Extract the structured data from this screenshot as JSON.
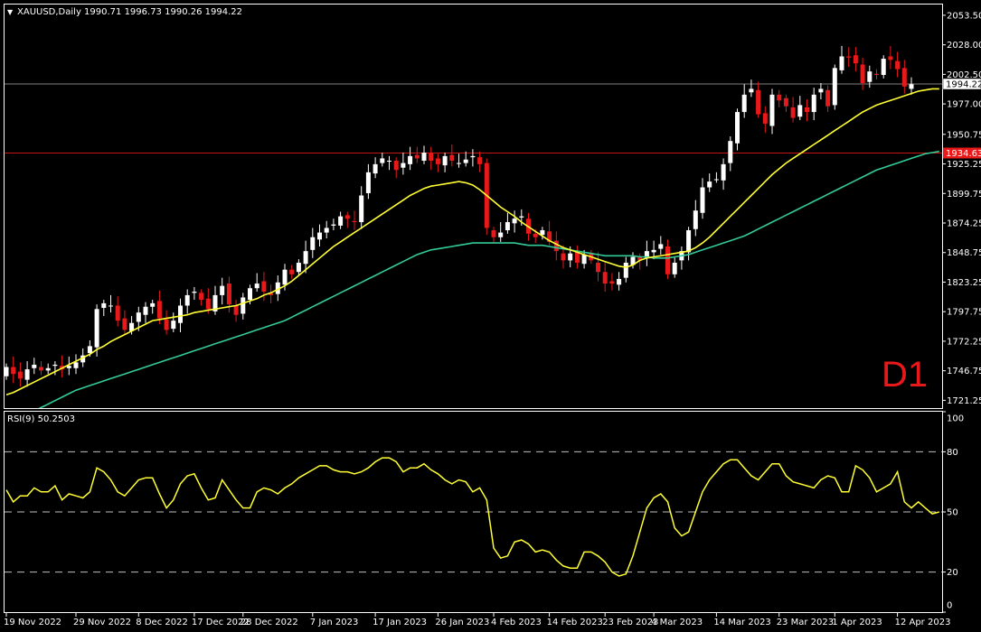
{
  "header": {
    "symbol_line": "XAUUSD,Daily  1990.71 1996.73 1990.26 1994.22",
    "rsi_label": "RSI(9) 50.2503",
    "timeframe_label": "D1"
  },
  "colors": {
    "background": "#000000",
    "frame": "#ffffff",
    "bull_candle": "#ffffff",
    "bear_candle": "#e8191a",
    "ma_fast": "#ffff33",
    "ma_slow": "#33cc99",
    "rsi_line": "#ffff33",
    "hline_current": "#808080",
    "hline_red": "#c81414",
    "price_tag_current": "#ffffff",
    "price_tag_red": "#e8191a"
  },
  "chart_data": [
    {
      "type": "candlestick",
      "symbol": "XAUUSD",
      "timeframe": "Daily",
      "ylim": [
        1714.55,
        2062.78
      ],
      "y_ticks": [
        "2053.50",
        "2028.00",
        "2002.50",
        "1977.00",
        "1950.75",
        "1925.25",
        "1899.75",
        "1874.25",
        "1848.75",
        "1823.25",
        "1797.75",
        "1772.25",
        "1746.75",
        "1721.25"
      ],
      "x_ticks": [
        "19 Nov 2022",
        "29 Nov 2022",
        "8 Dec 2022",
        "17 Dec 2022",
        "28 Dec 2022",
        "7 Jan 2023",
        "17 Jan 2023",
        "26 Jan 2023",
        "4 Feb 2023",
        "14 Feb 2023",
        "23 Feb 2023",
        "4 Mar 2023",
        "14 Mar 2023",
        "23 Mar 2023",
        "1 Apr 2023",
        "12 Apr 2023"
      ],
      "price_lines": [
        {
          "label": "1994.22",
          "value": 1994.22,
          "kind": "current"
        },
        {
          "label": "1934.63",
          "value": 1934.63,
          "kind": "level"
        }
      ],
      "closes": [
        1750,
        1744,
        1740,
        1748,
        1752,
        1747,
        1749,
        1752,
        1748,
        1751,
        1754,
        1760,
        1768,
        1800,
        1805,
        1803,
        1790,
        1782,
        1788,
        1797,
        1802,
        1805,
        1792,
        1782,
        1790,
        1803,
        1812,
        1815,
        1808,
        1800,
        1812,
        1820,
        1804,
        1795,
        1810,
        1818,
        1822,
        1815,
        1812,
        1823,
        1834,
        1830,
        1840,
        1850,
        1862,
        1866,
        1870,
        1873,
        1880,
        1878,
        1875,
        1898,
        1918,
        1925,
        1930,
        1928,
        1920,
        1926,
        1932,
        1930,
        1935,
        1928,
        1925,
        1932,
        1928,
        1926,
        1929,
        1932,
        1925,
        1870,
        1862,
        1866,
        1875,
        1878,
        1880,
        1865,
        1862,
        1868,
        1858,
        1850,
        1842,
        1848,
        1840,
        1847,
        1842,
        1832,
        1822,
        1822,
        1826,
        1840,
        1845,
        1842,
        1850,
        1851,
        1856,
        1830,
        1840,
        1850,
        1868,
        1885,
        1905,
        1910,
        1912,
        1925,
        1945,
        1970,
        1985,
        1990,
        1968,
        1960,
        1985,
        1980,
        1975,
        1965,
        1976,
        1970,
        1985,
        1990,
        1975,
        2008,
        2018,
        2017,
        2012,
        1995,
        2005,
        2002,
        2016,
        2015,
        2007,
        1992,
        1994
      ],
      "ma_fast": [
        1726,
        1728,
        1731,
        1734,
        1737,
        1740,
        1743,
        1746,
        1749,
        1752,
        1755,
        1758,
        1761,
        1765,
        1768,
        1772,
        1775,
        1778,
        1781,
        1784,
        1787,
        1790,
        1791,
        1792,
        1793,
        1794,
        1795,
        1797,
        1798,
        1799,
        1800,
        1801,
        1802,
        1803,
        1805,
        1807,
        1809,
        1812,
        1814,
        1817,
        1820,
        1824,
        1829,
        1834,
        1839,
        1844,
        1849,
        1854,
        1858,
        1862,
        1866,
        1870,
        1874,
        1878,
        1882,
        1886,
        1890,
        1894,
        1898,
        1901,
        1904,
        1906,
        1907,
        1908,
        1909,
        1910,
        1909,
        1907,
        1903,
        1898,
        1893,
        1888,
        1884,
        1880,
        1875,
        1871,
        1867,
        1863,
        1859,
        1856,
        1853,
        1851,
        1849,
        1847,
        1845,
        1843,
        1841,
        1839,
        1837,
        1836,
        1838,
        1842,
        1844,
        1845,
        1846,
        1847,
        1848,
        1849,
        1850,
        1853,
        1857,
        1862,
        1868,
        1874,
        1880,
        1886,
        1892,
        1898,
        1904,
        1910,
        1916,
        1921,
        1926,
        1930,
        1934,
        1938,
        1942,
        1946,
        1950,
        1954,
        1958,
        1962,
        1966,
        1970,
        1973,
        1976,
        1978,
        1980,
        1982,
        1984,
        1986,
        1988,
        1989,
        1990,
        1990
      ],
      "ma_slow": [
        1700,
        1703,
        1706,
        1709,
        1712,
        1715,
        1718,
        1721,
        1724,
        1727,
        1730,
        1732,
        1734,
        1736,
        1738,
        1740,
        1742,
        1744,
        1746,
        1748,
        1750,
        1752,
        1754,
        1756,
        1758,
        1760,
        1762,
        1764,
        1766,
        1768,
        1770,
        1772,
        1774,
        1776,
        1778,
        1780,
        1782,
        1784,
        1786,
        1788,
        1790,
        1793,
        1796,
        1799,
        1802,
        1805,
        1808,
        1811,
        1814,
        1817,
        1820,
        1823,
        1826,
        1829,
        1832,
        1835,
        1838,
        1841,
        1844,
        1847,
        1849,
        1851,
        1852,
        1853,
        1854,
        1855,
        1856,
        1857,
        1857,
        1857,
        1857,
        1857,
        1857,
        1857,
        1856,
        1855,
        1855,
        1855,
        1854,
        1853,
        1852,
        1851,
        1850,
        1849,
        1848,
        1847,
        1846,
        1846,
        1846,
        1846,
        1846,
        1845,
        1845,
        1844,
        1844,
        1844,
        1845,
        1846,
        1847,
        1849,
        1851,
        1853,
        1855,
        1857,
        1859,
        1861,
        1863,
        1866,
        1869,
        1872,
        1875,
        1878,
        1881,
        1884,
        1887,
        1890,
        1893,
        1896,
        1899,
        1902,
        1905,
        1908,
        1911,
        1914,
        1917,
        1920,
        1922,
        1924,
        1926,
        1928,
        1930,
        1932,
        1934,
        1935,
        1936
      ]
    },
    {
      "type": "line",
      "title": "RSI(9) 50.2503",
      "ylim": [
        0,
        100
      ],
      "y_ticks": [
        "100",
        "80",
        "50",
        "20",
        "0"
      ],
      "levels": [
        80,
        50,
        20
      ],
      "values": [
        61,
        55,
        58,
        58,
        62,
        60,
        60,
        63,
        56,
        59,
        58,
        57,
        60,
        72,
        70,
        66,
        60,
        58,
        62,
        66,
        67,
        67,
        59,
        52,
        56,
        64,
        68,
        69,
        62,
        56,
        57,
        66,
        61,
        56,
        52,
        52,
        60,
        62,
        61,
        59,
        62,
        64,
        67,
        69,
        71,
        73,
        73,
        71,
        70,
        70,
        69,
        70,
        72,
        75,
        77,
        77,
        75,
        70,
        72,
        72,
        74,
        71,
        69,
        66,
        64,
        66,
        65,
        60,
        62,
        56,
        32,
        27,
        28,
        35,
        36,
        34,
        30,
        31,
        30,
        26,
        23,
        22,
        22,
        30,
        30,
        28,
        25,
        20,
        18,
        19,
        28,
        40,
        52,
        57,
        59,
        55,
        42,
        38,
        40,
        50,
        60,
        66,
        70,
        74,
        76,
        76,
        72,
        68,
        66,
        70,
        74,
        74,
        68,
        65,
        64,
        63,
        62,
        66,
        68,
        67,
        60,
        60,
        73,
        71,
        67,
        60,
        62,
        64,
        70,
        55,
        52,
        55,
        52,
        49,
        50
      ]
    }
  ]
}
